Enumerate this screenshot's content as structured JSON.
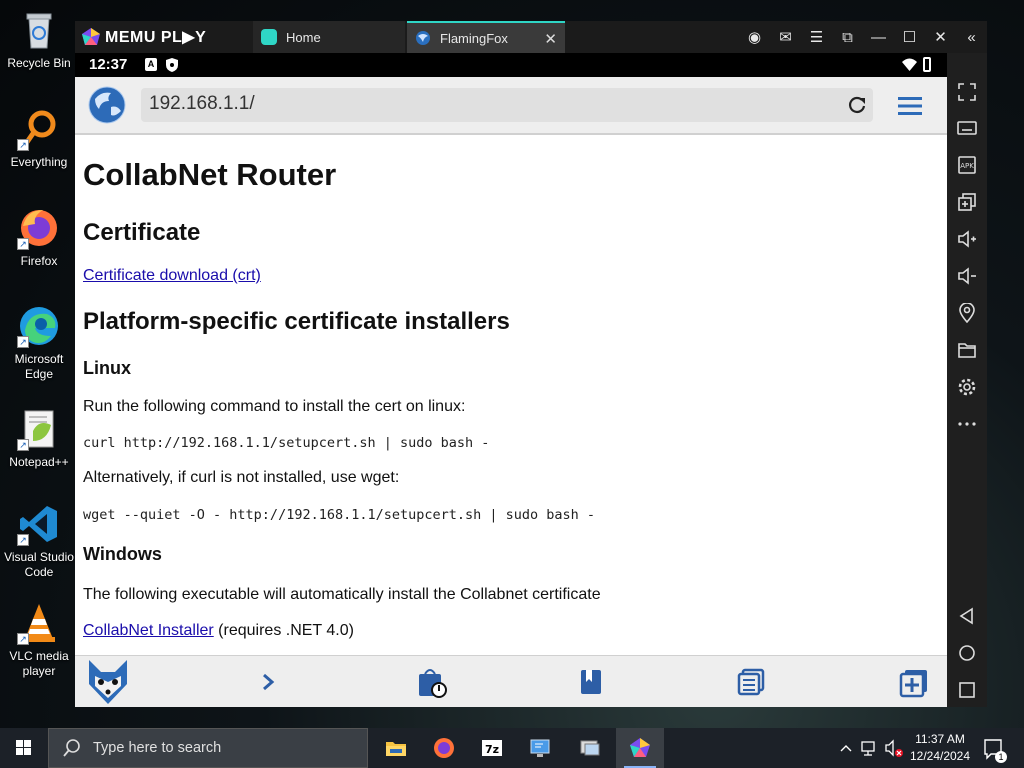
{
  "desktop": {
    "icons": [
      {
        "label": "Recycle Bin"
      },
      {
        "label": "Everything"
      },
      {
        "label": "Firefox"
      },
      {
        "label": "Microsoft Edge"
      },
      {
        "label": "Notepad++"
      },
      {
        "label": "Visual Studio Code"
      },
      {
        "label": "VLC media player"
      }
    ]
  },
  "memu": {
    "logo_text": "MEMU PL▶Y",
    "tabs": [
      {
        "label": "Home"
      },
      {
        "label": "FlamingFox"
      }
    ],
    "accent_color": "#2fd6c6"
  },
  "android": {
    "status": {
      "time": "12:37",
      "badge": "A"
    },
    "browser": {
      "url": "192.168.1.1/",
      "page": {
        "title": "CollabNet Router",
        "cert_heading": "Certificate",
        "cert_link": "Certificate download (crt)",
        "platform_heading": "Platform-specific certificate installers",
        "linux_heading": "Linux",
        "linux_intro": "Run the following command to install the cert on linux:",
        "linux_curl": "curl http://192.168.1.1/setupcert.sh | sudo bash -",
        "linux_alt": "Alternatively, if curl is not installed, use wget:",
        "linux_wget": "wget --quiet -O - http://192.168.1.1/setupcert.sh | sudo bash -",
        "windows_heading": "Windows",
        "windows_intro": "The following executable will automatically install the Collabnet certificate",
        "installer_link": "CollabNet Installer",
        "installer_note": " (requires .NET 4.0)"
      }
    }
  },
  "taskbar": {
    "search_placeholder": "Type here to search",
    "time": "11:37 AM",
    "date": "12/24/2024",
    "notification_count": "1"
  }
}
